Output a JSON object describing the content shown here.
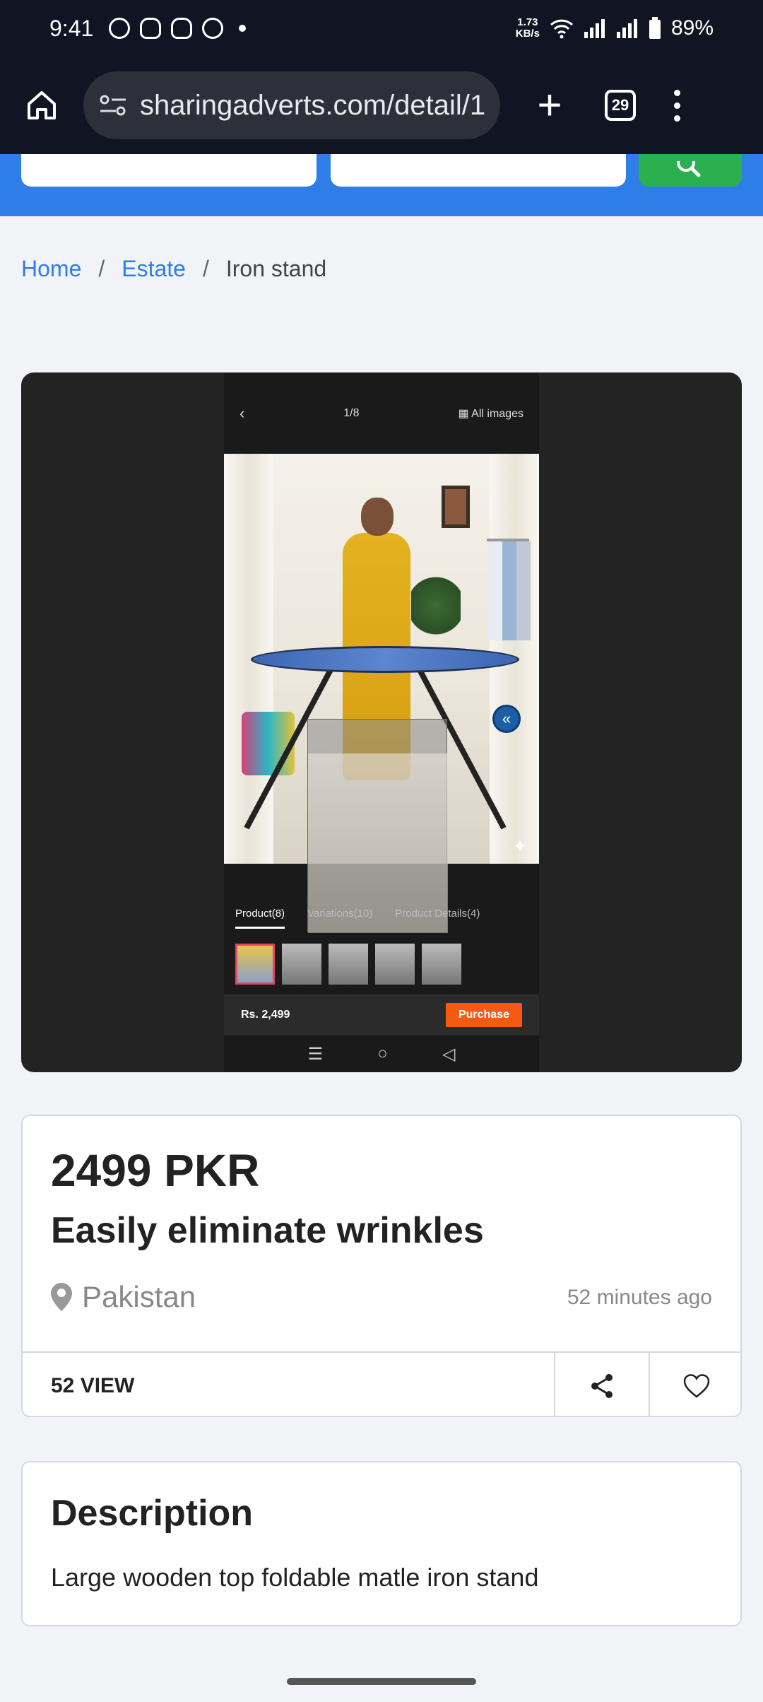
{
  "status_bar": {
    "time": "9:41",
    "net_speed": "1.73",
    "net_unit": "KB/s",
    "battery": "89%",
    "notification_icons": [
      "whatsapp-icon",
      "snapchat-icon",
      "snapchat-icon",
      "whatsapp-business-icon",
      "dot-icon"
    ]
  },
  "browser": {
    "url": "sharingadverts.com/detail/1",
    "tab_count": "29"
  },
  "breadcrumb": {
    "items": [
      "Home",
      "Estate"
    ],
    "current": "Iron stand",
    "separator": "/"
  },
  "gallery": {
    "counter": "1/8",
    "all_images_label": "All images",
    "tabs": [
      "Product(8)",
      "Variations(10)",
      "Product Details(4)"
    ],
    "price": "Rs. 2,499",
    "purchase_label": "Purchase",
    "nav_icons": [
      "☰",
      "○",
      "◁"
    ]
  },
  "listing": {
    "price": "2499 PKR",
    "title": "Easily eliminate wrinkles",
    "location": "Pakistan",
    "posted": "52 minutes ago",
    "views": "52 VIEW"
  },
  "description": {
    "heading": "Description",
    "text": "Large wooden top foldable matle iron stand"
  },
  "colors": {
    "accent": "#2f7de8",
    "search_button": "#2ab04e",
    "purchase": "#f45a12",
    "toolbar": "#111523"
  }
}
